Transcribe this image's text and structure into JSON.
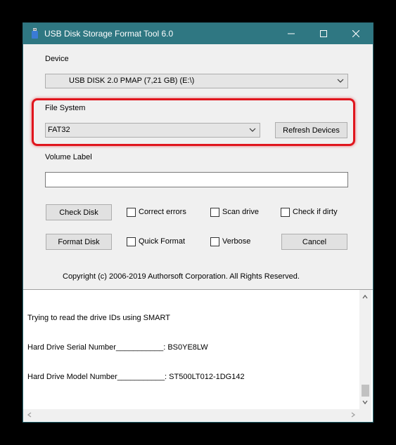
{
  "window": {
    "title": "USB Disk Storage Format Tool 6.0",
    "title_bar_color": "#2f7782"
  },
  "device": {
    "label": "Device",
    "selected": "USB DISK 2.0  PMAP (7,21 GB) (E:\\)"
  },
  "file_system": {
    "label": "File System",
    "selected": "FAT32",
    "refresh_label": "Refresh Devices"
  },
  "volume_label": {
    "label": "Volume Label",
    "value": ""
  },
  "actions": {
    "check_disk": "Check Disk",
    "format_disk": "Format Disk",
    "cancel": "Cancel"
  },
  "options": {
    "correct_errors": "Correct errors",
    "scan_drive": "Scan drive",
    "check_if_dirty": "Check if dirty",
    "quick_format": "Quick Format",
    "verbose": "Verbose"
  },
  "copyright": "Copyright (c) 2006-2019 Authorsoft Corporation. All Rights Reserved.",
  "log": {
    "lines": [
      "Trying to read the drive IDs using SMART",
      "Hard Drive Serial Number___________: BS0YE8LW",
      "Hard Drive Model Number___________: ST500LT012-1DG142"
    ]
  },
  "highlight_color": "#e0151d"
}
